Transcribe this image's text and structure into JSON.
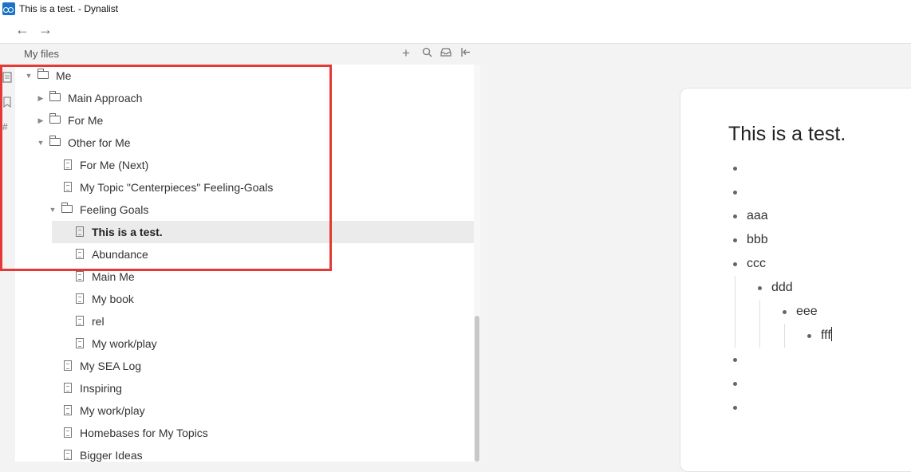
{
  "window": {
    "title": "This is a test. - Dynalist"
  },
  "sidebar": {
    "title": "My files",
    "tree": [
      {
        "label": "Me",
        "type": "folder",
        "expanded": true,
        "depth": 0
      },
      {
        "label": "Main Approach",
        "type": "folder",
        "expanded": false,
        "depth": 1
      },
      {
        "label": "For Me",
        "type": "folder",
        "expanded": false,
        "depth": 1
      },
      {
        "label": "Other for Me",
        "type": "folder",
        "expanded": true,
        "depth": 1
      },
      {
        "label": "For Me (Next)",
        "type": "doc",
        "depth": 2
      },
      {
        "label": "My Topic \"Centerpieces\" Feeling-Goals",
        "type": "doc",
        "depth": 2
      },
      {
        "label": "Feeling Goals",
        "type": "folder",
        "expanded": true,
        "depth": 2
      },
      {
        "label": "This is a test.",
        "type": "doc",
        "depth": 3,
        "selected": true
      },
      {
        "label": "Abundance",
        "type": "doc",
        "depth": 3
      },
      {
        "label": "Main Me",
        "type": "doc",
        "depth": 3
      },
      {
        "label": "My book",
        "type": "doc",
        "depth": 3
      },
      {
        "label": "rel",
        "type": "doc",
        "depth": 3
      },
      {
        "label": "My work/play",
        "type": "doc",
        "depth": 3
      },
      {
        "label": "My SEA Log",
        "type": "doc",
        "depth": 2
      },
      {
        "label": "Inspiring",
        "type": "doc",
        "depth": 2
      },
      {
        "label": "My work/play",
        "type": "doc",
        "depth": 2
      },
      {
        "label": "Homebases for My Topics",
        "type": "doc",
        "depth": 2
      },
      {
        "label": "Bigger Ideas",
        "type": "doc",
        "depth": 2
      }
    ]
  },
  "document": {
    "title": "This is a test.",
    "bullets": [
      {
        "text": "",
        "depth": 0
      },
      {
        "text": "",
        "depth": 0
      },
      {
        "text": "aaa",
        "depth": 0
      },
      {
        "text": "bbb",
        "depth": 0
      },
      {
        "text": "ccc",
        "depth": 0
      },
      {
        "text": "ddd",
        "depth": 1
      },
      {
        "text": "eee",
        "depth": 2
      },
      {
        "text": "fff",
        "depth": 3,
        "caret": true
      },
      {
        "text": "",
        "depth": 0
      },
      {
        "text": "",
        "depth": 0
      },
      {
        "text": "",
        "depth": 0
      }
    ]
  },
  "colors": {
    "highlight": "#e53935",
    "selected_row": "#ebebeb",
    "app_icon": "#1a72c9"
  }
}
